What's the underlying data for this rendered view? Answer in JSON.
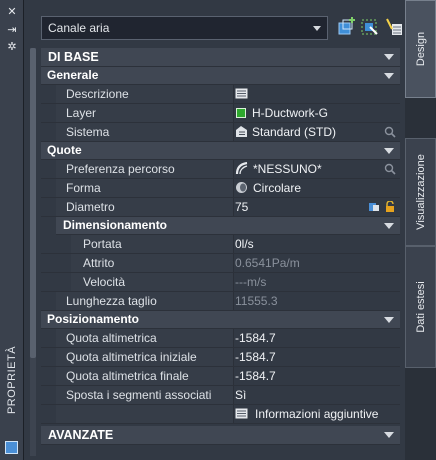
{
  "palette": {
    "title": "PROPRIETÀ"
  },
  "toolbar": {
    "selector_value": "Canale aria",
    "icons": [
      "quick-select-icon",
      "select-objects-icon",
      "toggle-pickadd-icon"
    ]
  },
  "sections": {
    "base": "DI BASE",
    "generale": {
      "title": "Generale",
      "descrizione": {
        "label": "Descrizione"
      },
      "layer": {
        "label": "Layer",
        "value": "H-Ductwork-G"
      },
      "sistema": {
        "label": "Sistema",
        "value": "Standard (STD)"
      }
    },
    "quote": {
      "title": "Quote",
      "preferenza": {
        "label": "Preferenza percorso",
        "value": "*NESSUNO*"
      },
      "forma": {
        "label": "Forma",
        "value": "Circolare"
      },
      "diametro": {
        "label": "Diametro",
        "value": "75"
      },
      "dimensionamento": {
        "title": "Dimensionamento",
        "portata": {
          "label": "Portata",
          "value": "0l/s"
        },
        "attrito": {
          "label": "Attrito",
          "value": "0.6541Pa/m"
        },
        "velocita": {
          "label": "Velocità",
          "value": "---m/s"
        }
      },
      "lunghezza": {
        "label": "Lunghezza taglio",
        "value": "11555.3"
      }
    },
    "posizionamento": {
      "title": "Posizionamento",
      "quota": {
        "label": "Quota altimetrica",
        "value": "-1584.7"
      },
      "quota_iniziale": {
        "label": "Quota altimetrica iniziale",
        "value": "-1584.7"
      },
      "quota_finale": {
        "label": "Quota altimetrica finale",
        "value": "-1584.7"
      },
      "sposta": {
        "label": "Sposta i segmenti associati",
        "value": "Sì"
      },
      "info": {
        "value": "Informazioni aggiuntive"
      }
    },
    "avanzate": "AVANZATE"
  },
  "tabs": [
    "Design",
    "Visualizzazione",
    "Dati estesi"
  ],
  "colors": {
    "layer_swatch": "#2ea82e",
    "accent": "#4a8fd6"
  }
}
